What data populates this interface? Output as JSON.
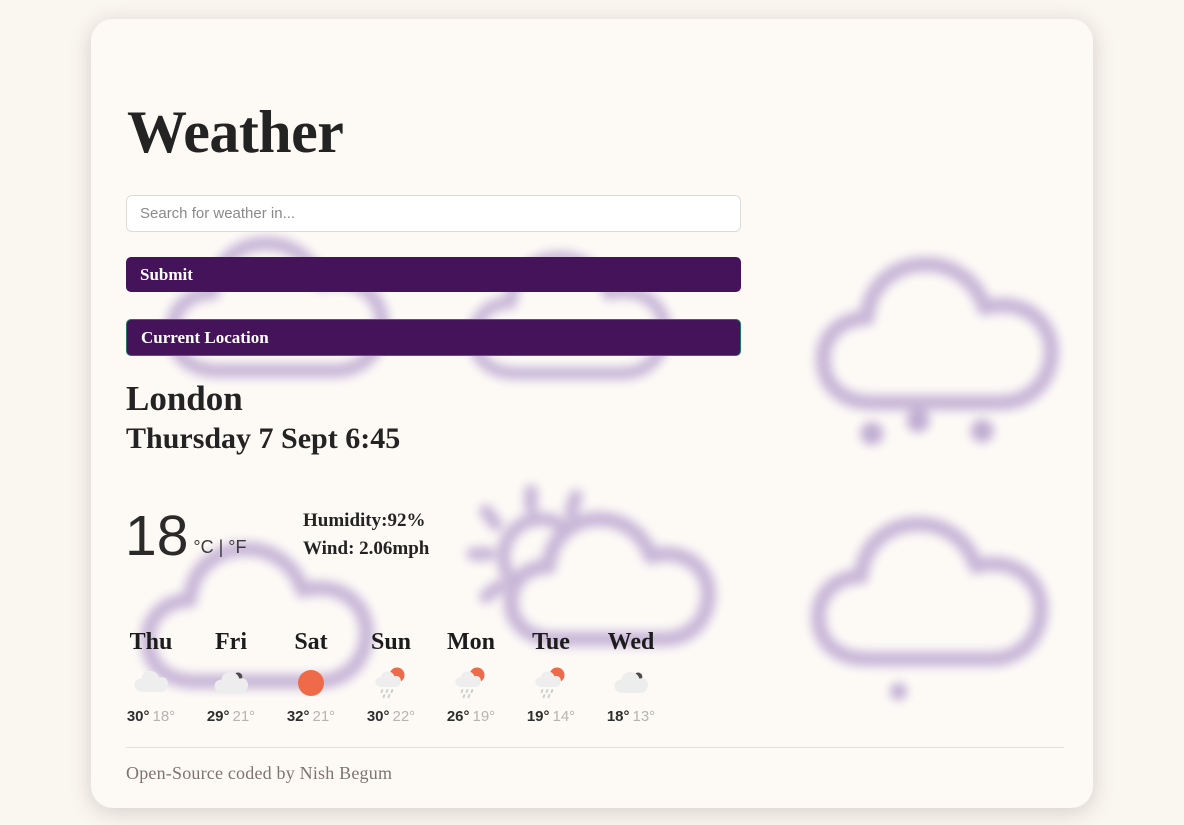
{
  "app": {
    "title": "Weather",
    "background_color": "#faf6f0",
    "card_color": "#fdfaf6",
    "accent_color": "#44135a",
    "border_accent_color": "#1d7a5e",
    "sun_color": "#ef6a48",
    "deco_color": "#b49ccc"
  },
  "search": {
    "placeholder": "Search for weather in...",
    "value": ""
  },
  "buttons": {
    "submit_label": "Submit",
    "current_location_label": "Current Location"
  },
  "current": {
    "city": "London",
    "date": "Thursday 7 Sept 6:45",
    "temperature": "18",
    "units": "°C | °F",
    "humidity": "Humidity:92%",
    "wind": "Wind: 2.06mph"
  },
  "forecast": [
    {
      "day": "Thu",
      "icon": "cloud-icon",
      "high": "30°",
      "low": "18°"
    },
    {
      "day": "Fri",
      "icon": "broken-clouds-icon",
      "high": "29°",
      "low": "21°"
    },
    {
      "day": "Sat",
      "icon": "sun-icon",
      "high": "32°",
      "low": "21°"
    },
    {
      "day": "Sun",
      "icon": "sun-shower-icon",
      "high": "30°",
      "low": "22°"
    },
    {
      "day": "Mon",
      "icon": "sun-shower-icon",
      "high": "26°",
      "low": "19°"
    },
    {
      "day": "Tue",
      "icon": "sun-shower-icon",
      "high": "19°",
      "low": "14°"
    },
    {
      "day": "Wed",
      "icon": "broken-clouds-icon",
      "high": "18°",
      "low": "13°"
    }
  ],
  "footer": {
    "credit": "Open-Source coded by Nish Begum"
  },
  "decorations": [
    {
      "name": "deco-cloud-topleft",
      "icon": "cloud-outline-icon"
    },
    {
      "name": "deco-cloud-midleft",
      "icon": "cloud-outline-icon"
    },
    {
      "name": "deco-cloud-topmid",
      "icon": "cloud-outline-icon"
    },
    {
      "name": "deco-sun-center",
      "icon": "sun-behind-cloud-outline-icon"
    },
    {
      "name": "deco-snow-right",
      "icon": "snow-cloud-outline-icon"
    },
    {
      "name": "deco-cloud-right",
      "icon": "drizzle-cloud-outline-icon"
    }
  ]
}
